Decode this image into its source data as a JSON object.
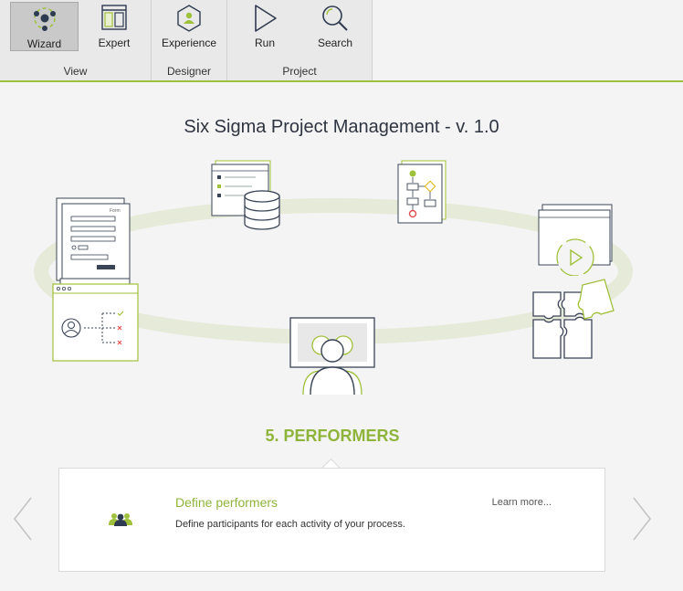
{
  "toolbar": {
    "buttons": [
      {
        "label": "Wizard",
        "icon": "wizard-icon",
        "active": true
      },
      {
        "label": "Expert",
        "icon": "expert-icon"
      },
      {
        "label": "Experience",
        "icon": "experience-icon"
      },
      {
        "label": "Run",
        "icon": "run-icon"
      },
      {
        "label": "Search",
        "icon": "search-icon"
      }
    ],
    "groups": [
      "View",
      "Designer",
      "Project"
    ]
  },
  "main": {
    "title": "Six Sigma Project Management - v. 1.0",
    "step_title": "5. PERFORMERS"
  },
  "card": {
    "title": "Define performers",
    "description": "Define participants for each activity of your process.",
    "link": "Learn more...",
    "icon": "performers-icon"
  },
  "illustration_labels": {
    "form_caption": "Form"
  },
  "colors": {
    "accent": "#8fb43b",
    "ribbon_border": "#9fc03a",
    "text_dark": "#2e3440",
    "ellipse": "#e6ead8"
  }
}
